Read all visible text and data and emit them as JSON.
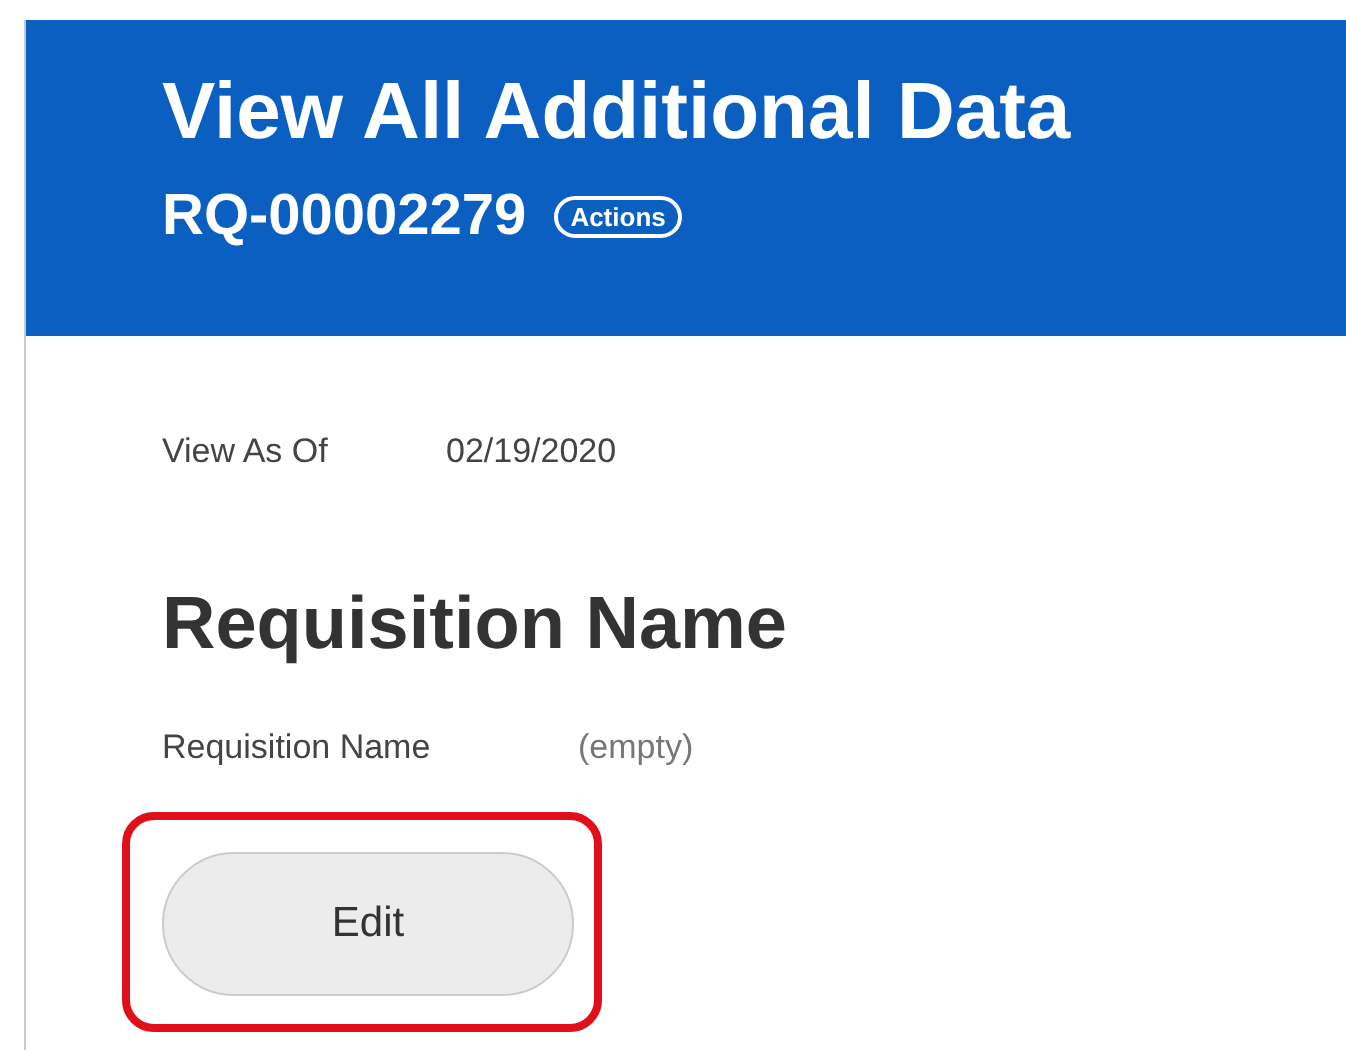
{
  "header": {
    "title": "View All Additional Data",
    "subtitle": "RQ-00002279",
    "actions_label": "Actions"
  },
  "view_as_of": {
    "label": "View As Of",
    "value": "02/19/2020"
  },
  "section": {
    "heading": "Requisition Name",
    "field_label": "Requisition Name",
    "field_value": "(empty)"
  },
  "edit_button": {
    "label": "Edit",
    "highlighted": true
  }
}
